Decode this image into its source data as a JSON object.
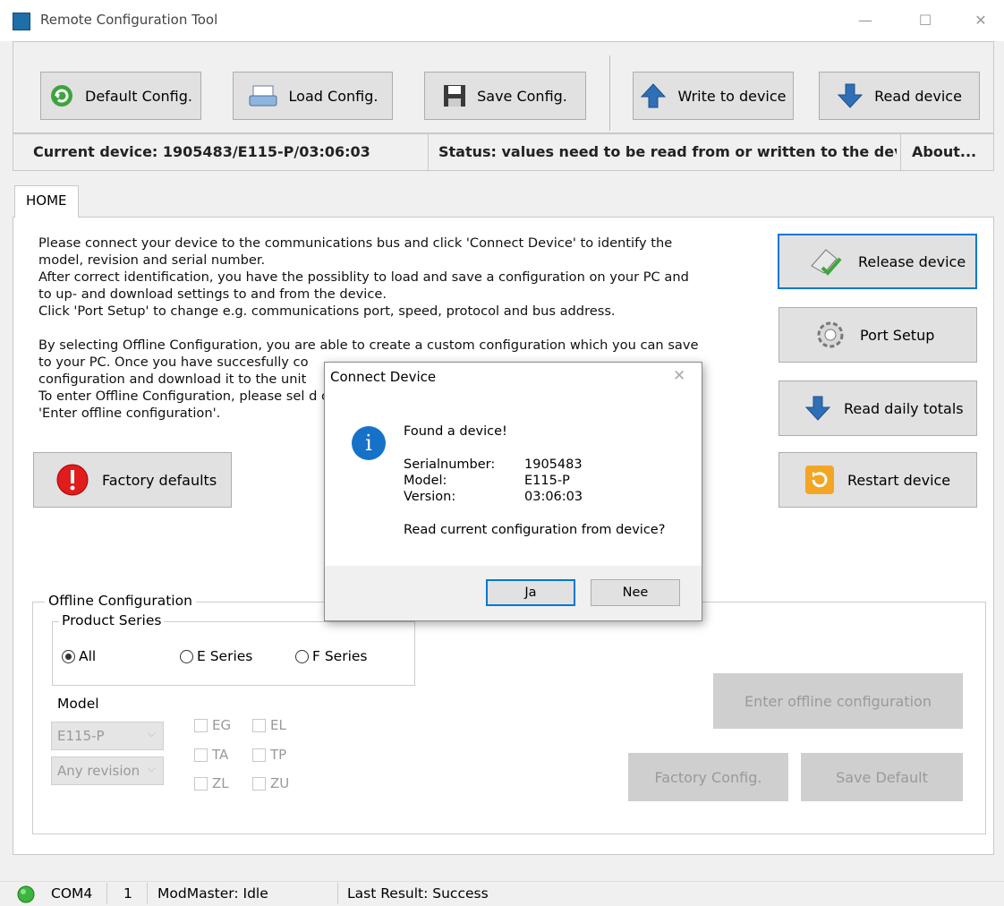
{
  "window": {
    "title": "Remote Configuration Tool",
    "minimize": "—",
    "maximize": "☐",
    "close": "✕"
  },
  "toolbar": {
    "default_config": "Default Config.",
    "load_config": "Load Config.",
    "save_config": "Save Config.",
    "write_device": "Write to device",
    "read_device": "Read device"
  },
  "info": {
    "current_device": "Current device: 1905483/E115-P/03:06:03",
    "status": "Status: values need to be read from or written to the devi",
    "about": "About..."
  },
  "tabs": [
    {
      "label": "HOME"
    }
  ],
  "home": {
    "intro": "Please connect your device to the communications bus and click 'Connect Device' to identify the\nmodel, revision and serial number.\nAfter correct identification, you have the possiblity to load and save a configuration on your PC and\nto up- and download settings to and from the device.\nClick 'Port Setup' to change e.g. communications port, speed, protocol and bus address.\n\nBy selecting Offline Configuration, you are able to create a custom configuration which you can save\nto your PC. Once you have succesfully co\nconfiguration and download it to the unit\nTo enter Offline Configuration, please sel                                                              d click\n'Enter offline configuration'.",
    "factory_defaults": "Factory defaults",
    "release_device": "Release device",
    "port_setup": "Port Setup",
    "read_daily_totals": "Read daily totals",
    "restart_device": "Restart device"
  },
  "offline": {
    "title": "Offline Configuration",
    "product_series_title": "Product Series",
    "series": [
      {
        "label": "All",
        "selected": true
      },
      {
        "label": "E Series",
        "selected": false
      },
      {
        "label": "F Series",
        "selected": false
      }
    ],
    "model_label": "Model",
    "model_value": "E115-P",
    "revision_value": "Any revision",
    "checkboxes": [
      "EG",
      "EL",
      "TA",
      "TP",
      "ZL",
      "ZU"
    ],
    "enter_offline": "Enter offline configuration",
    "factory_config": "Factory Config.",
    "save_default": "Save Default"
  },
  "statusbar": {
    "port": "COM4",
    "address": "1",
    "modmaster": "ModMaster: Idle",
    "last_result": "Last Result: Success",
    "led_color": "#3bb53b"
  },
  "dialog": {
    "title": "Connect Device",
    "close": "✕",
    "heading": "Found a device!",
    "serial_label": "Serialnumber:",
    "serial_value": "1905483",
    "model_label": "Model:",
    "model_value": "E115-P",
    "version_label": "Version:",
    "version_value": "03:06:03",
    "question": "Read current configuration from device?",
    "yes": "Ja",
    "no": "Nee",
    "icon_glyph": "i"
  }
}
